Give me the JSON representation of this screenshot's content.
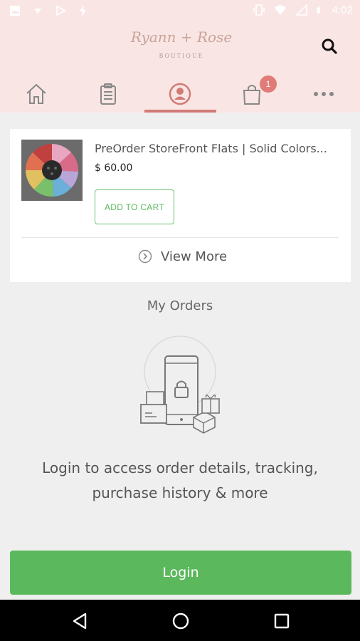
{
  "status_bar": {
    "time": "4:02",
    "icons": [
      "image-icon",
      "download-icon",
      "play-store-icon",
      "flash-icon",
      "vibrate-icon",
      "wifi-icon",
      "signal-icon",
      "battery-icon"
    ]
  },
  "header": {
    "logo_text": "Ryann + Rose",
    "logo_subtext": "BOUTIQUE",
    "search_icon": "search-icon"
  },
  "nav": {
    "items": [
      {
        "name": "home",
        "icon": "home-icon"
      },
      {
        "name": "orders",
        "icon": "clipboard-icon"
      },
      {
        "name": "account",
        "icon": "user-icon",
        "active": true
      },
      {
        "name": "cart",
        "icon": "shopping-bag-icon",
        "badge": "1"
      },
      {
        "name": "more",
        "icon": "more-icon"
      }
    ]
  },
  "product": {
    "title": "PreOrder StoreFront Flats | Solid Colors...",
    "price": "$ 60.00",
    "add_to_cart_label": "ADD TO CART"
  },
  "view_more_label": "View More",
  "orders": {
    "title": "My Orders",
    "message_line1": "Login to access order details, tracking,",
    "message_line2": "purchase history & more"
  },
  "login_button_label": "Login",
  "colors": {
    "header_bg": "#f9e6e4",
    "accent": "#d27a76",
    "green": "#5cb85c"
  }
}
